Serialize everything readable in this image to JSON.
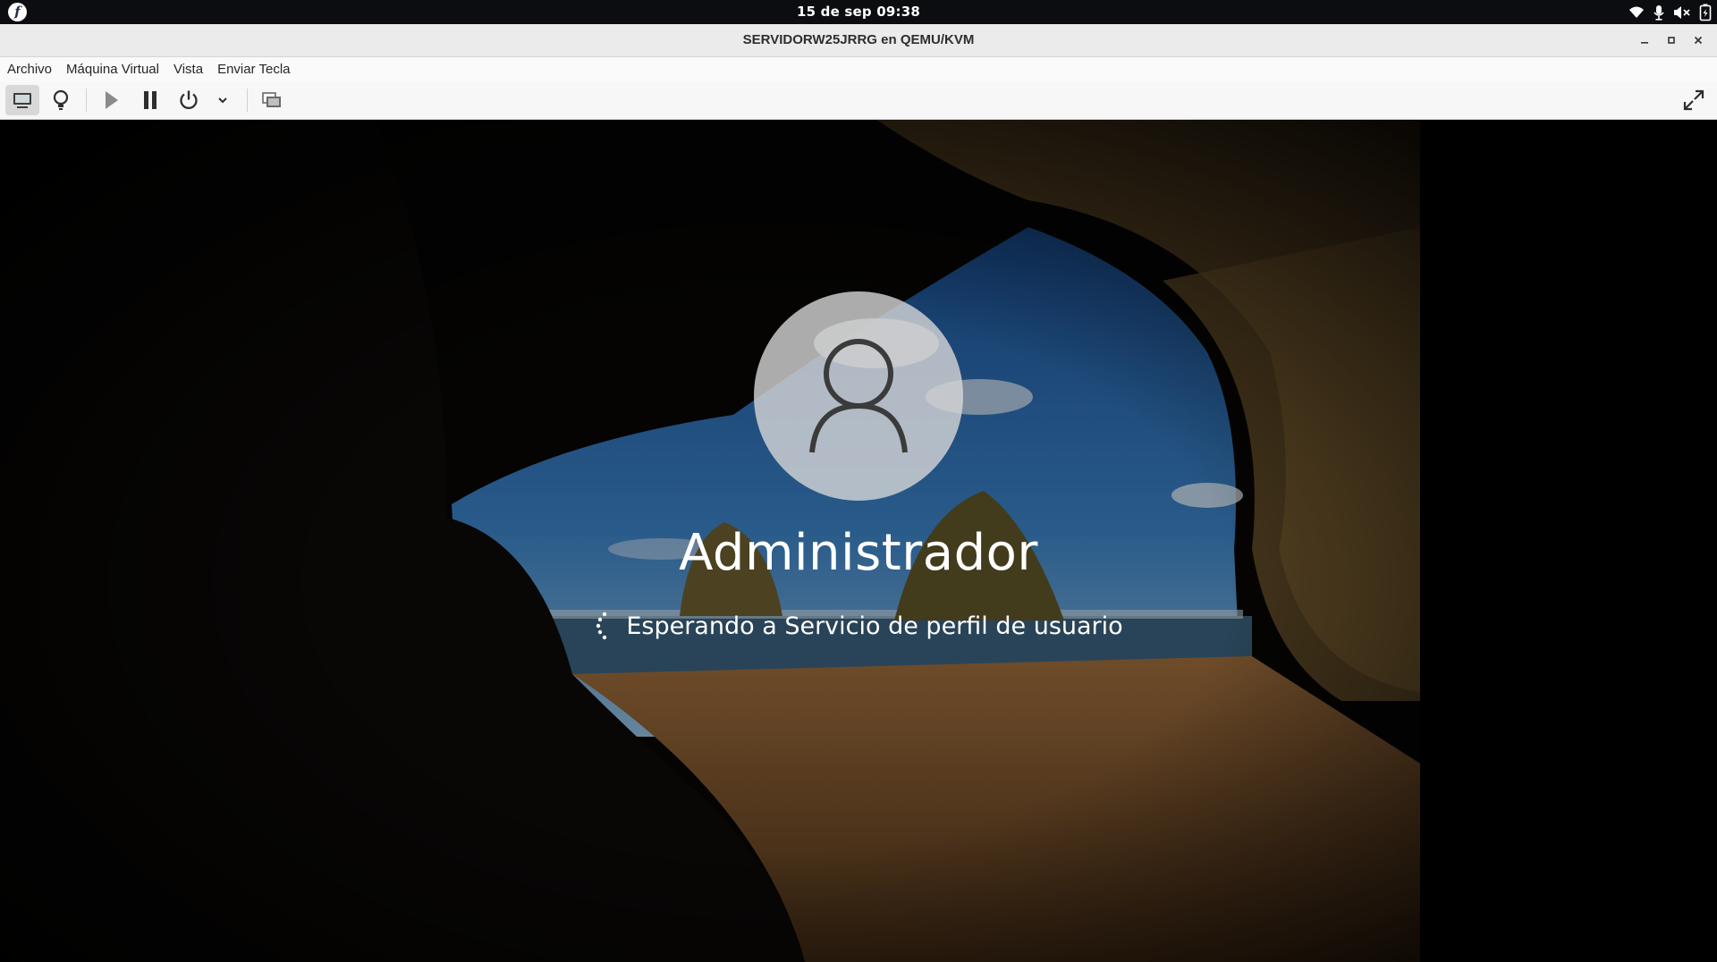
{
  "topbar": {
    "clock": "15 de sep  09:38"
  },
  "window": {
    "title": "SERVIDORW25JRRG en QEMU/KVM"
  },
  "menu": {
    "items": [
      "Archivo",
      "Máquina Virtual",
      "Vista",
      "Enviar Tecla"
    ]
  },
  "toolbar": {
    "icons": [
      "display-console-icon",
      "lightbulb-details-icon",
      "play-icon",
      "pause-icon",
      "power-icon",
      "chevron-down-icon",
      "snapshots-icon",
      "fullscreen-icon"
    ]
  },
  "guest": {
    "user_name": "Administrador",
    "status": "Esperando a Servicio de perfil de usuario"
  },
  "colors": {
    "topbar_bg": "#0b0d10",
    "titlebar_bg": "#ebebeb",
    "toolbar_bg": "#f7f7f7",
    "console_bg": "#000000"
  }
}
